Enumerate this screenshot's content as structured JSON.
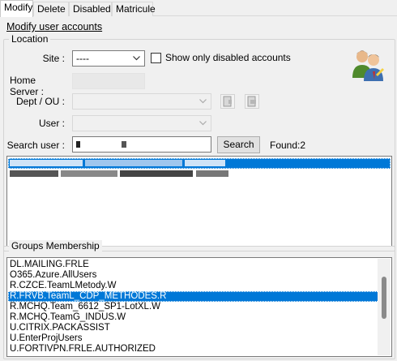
{
  "tabs": [
    {
      "label": "Modify",
      "active": true
    },
    {
      "label": "Delete",
      "active": false
    },
    {
      "label": "Disabled",
      "active": false
    },
    {
      "label": "Matricule",
      "active": false
    }
  ],
  "section_title": "Modify user accounts",
  "location": {
    "group_label": "Location",
    "site_label": "Site :",
    "site_value": "----",
    "disabled_checkbox_label": "Show only disabled accounts",
    "disabled_checkbox_checked": false,
    "home_server_label": "Home Server :",
    "dept_label": "Dept / OU :",
    "user_label": "User :",
    "search_user_label": "Search user :",
    "search_button": "Search",
    "found_text": "Found:2"
  },
  "users_list": {
    "rows": [
      {
        "selected": true,
        "redacted": true
      },
      {
        "selected": false,
        "redacted": true
      }
    ]
  },
  "groups": {
    "group_label": "Groups Membership",
    "items": [
      {
        "label": "DL.MAILING.FRLE",
        "selected": false
      },
      {
        "label": "O365.Azure.AllUsers",
        "selected": false
      },
      {
        "label": "R.CZCE.TeamLMetody.W",
        "selected": false
      },
      {
        "label": "R.FRVB.TeamL_CDP_METHODES.R",
        "selected": true
      },
      {
        "label": "R.MCHQ.Team_6612_SP1-LotXL.W",
        "selected": false
      },
      {
        "label": "R.MCHQ.TeamG_INDUS.W",
        "selected": false
      },
      {
        "label": "U.CITRIX.PACKASSIST",
        "selected": false
      },
      {
        "label": "U.EnterProjUsers",
        "selected": false
      },
      {
        "label": "U.FORTIVPN.FRLE.AUTHORIZED",
        "selected": false
      }
    ]
  },
  "colors": {
    "selection": "#0078d7",
    "window_bg": "#f0f0f0"
  },
  "icons": {
    "users_icon": "users-icon",
    "dropdown_arrow": "chevron-down-icon",
    "dept_action_1": "document-icon",
    "dept_action_2": "document-icon"
  }
}
